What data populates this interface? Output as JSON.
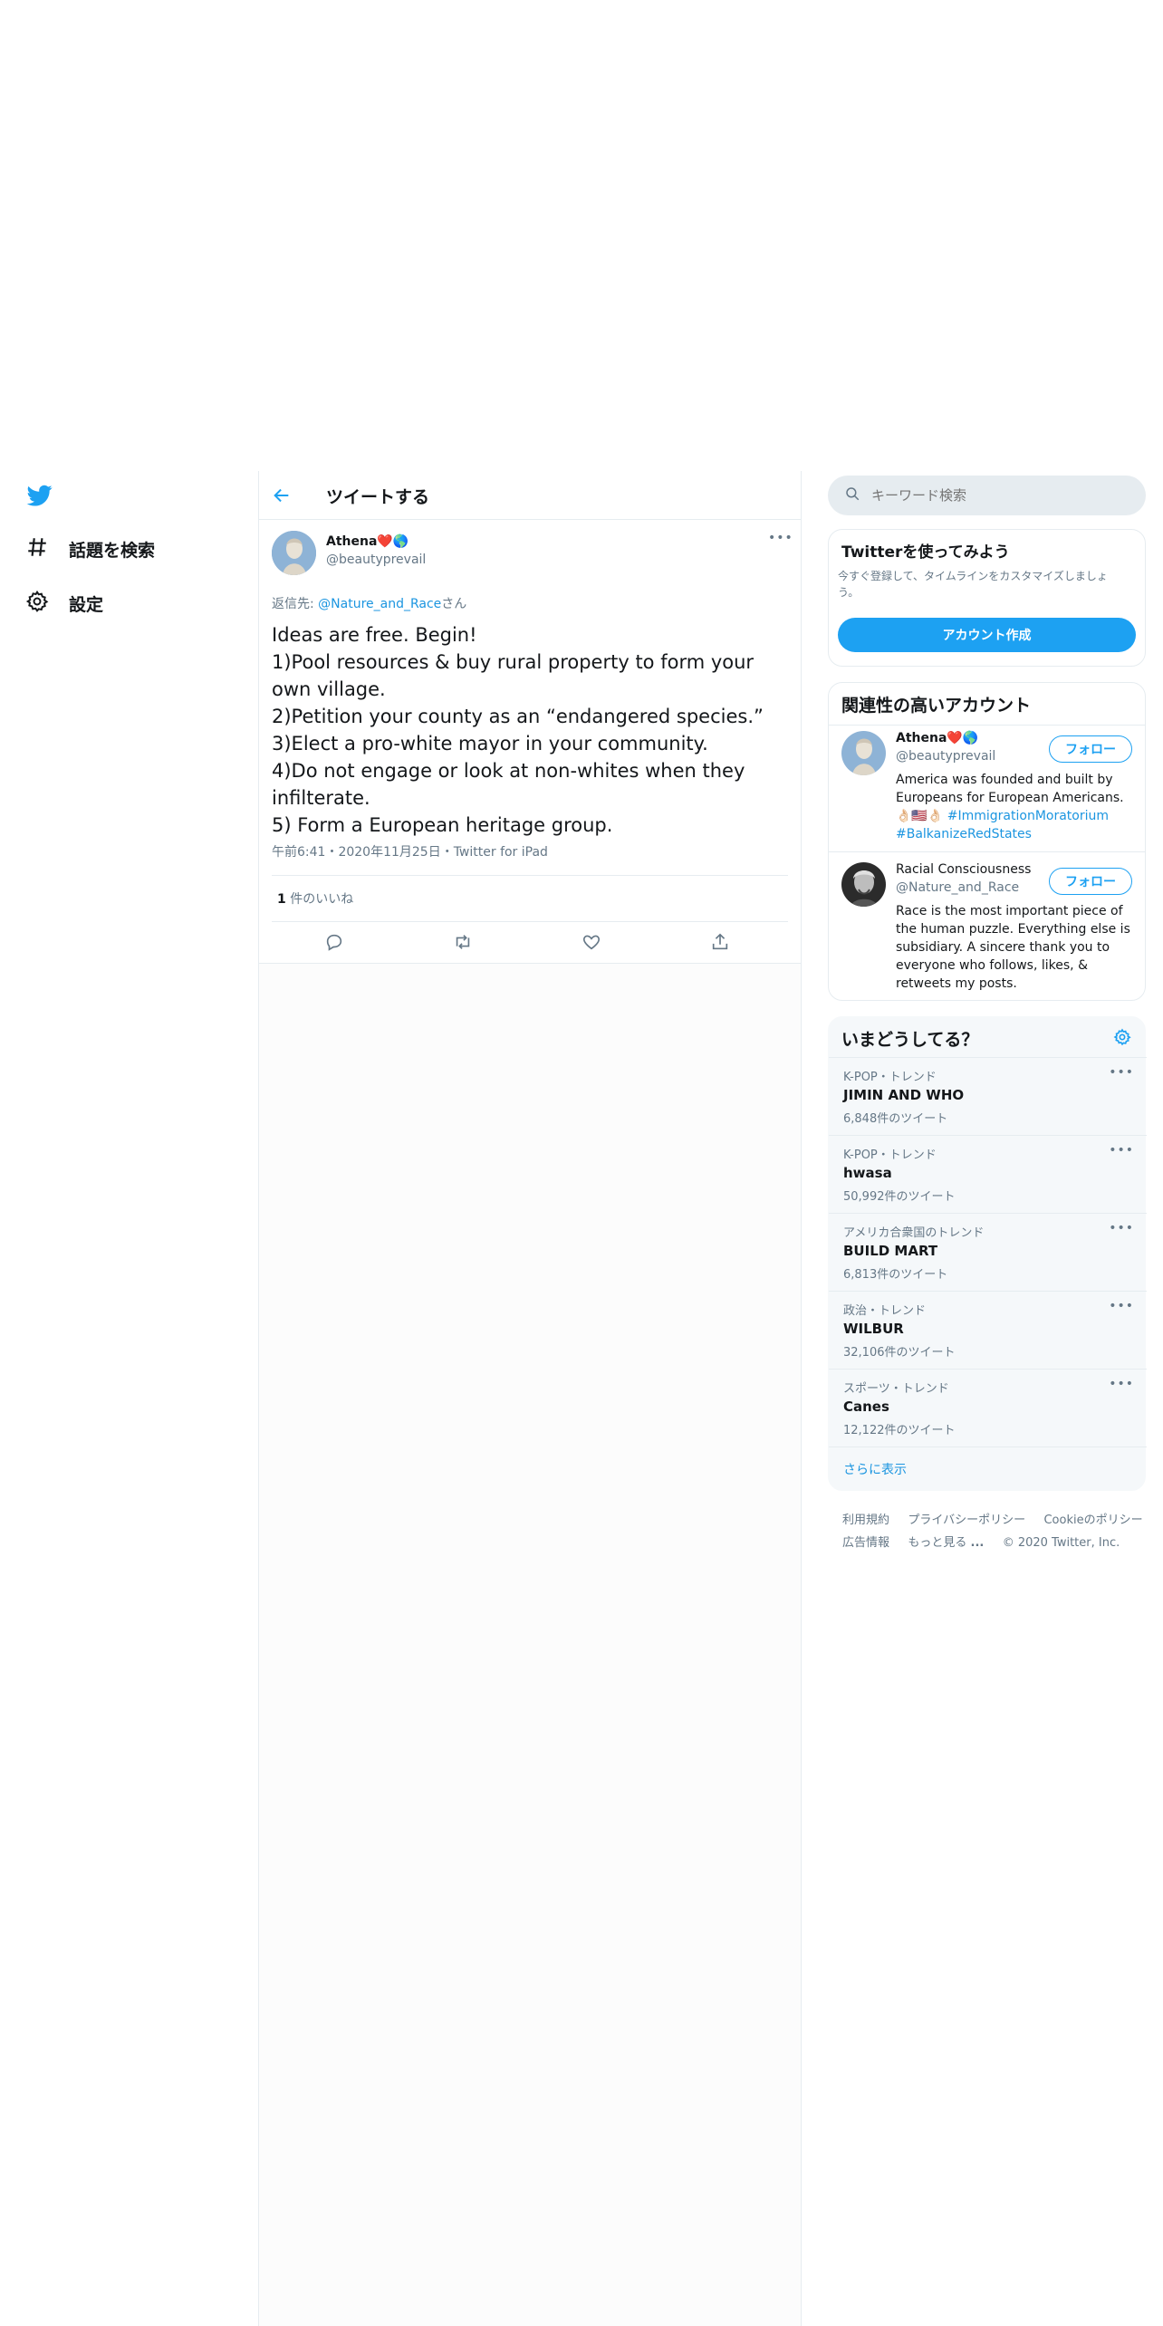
{
  "nav": {
    "items": [
      {
        "icon": "hashtag-icon",
        "label": "話題を検索"
      },
      {
        "icon": "gear-icon",
        "label": "設定"
      }
    ]
  },
  "header": {
    "title": "ツイートする"
  },
  "tweet": {
    "author_name": "Athena❤️🌎",
    "author_handle": "@beautyprevail",
    "reply_prefix": "返信先: ",
    "reply_to": "@Nature_and_Race",
    "reply_suffix": "さん",
    "lines": [
      "Ideas are free. Begin!",
      "1)Pool resources & buy rural property to form your",
      "own village.",
      "2)Petition your county as an “endangered species.”",
      "3)Elect a pro-white mayor in your community.",
      "4)Do not engage or look at non-whites when they",
      "infilterate.",
      "5) Form a European heritage group."
    ],
    "meta": "午前6:41・2020年11月25日・Twitter for iPad",
    "likes_count": "1",
    "likes_label": " 件のいいね"
  },
  "search": {
    "placeholder": "キーワード検索"
  },
  "signup": {
    "title": "Twitterを使ってみよう",
    "desc_line1": "今すぐ登録して、タイムラインをカスタマイズしましょ",
    "desc_line2": "う。",
    "button": "アカウント作成"
  },
  "relevant": {
    "title": "関連性の高いアカウント",
    "follow_label": "フォロー",
    "accounts": [
      {
        "name": "Athena❤️🌎",
        "handle": "@beautyprevail",
        "bio_line1": "America was founded and built by",
        "bio_line2": "Europeans for European Americans.",
        "bio_emoji": "👌🏻🇺🇸👌🏻",
        "bio_tag1": "#ImmigrationMoratorium",
        "bio_tag2": "#BalkanizeRedStates"
      },
      {
        "name": "Racial Consciousness",
        "handle": "@Nature_and_Race",
        "bio_lines": [
          "Race is the most important piece of",
          "the human puzzle. Everything else is",
          "subsidiary. A sincere thank you to",
          "everyone who follows, likes, &",
          "retweets my posts."
        ]
      }
    ]
  },
  "trends": {
    "title": "いまどうしてる？",
    "items": [
      {
        "category": "K-POP・トレンド",
        "name": "JIMIN AND WHO",
        "count": "6,848件のツイート"
      },
      {
        "category": "K-POP・トレンド",
        "name": "hwasa",
        "count": "50,992件のツイート"
      },
      {
        "category": "アメリカ合衆国のトレンド",
        "name": "BUILD MART",
        "count": "6,813件のツイート"
      },
      {
        "category": "政治・トレンド",
        "name": "WILBUR",
        "count": "32,106件のツイート"
      },
      {
        "category": "スポーツ・トレンド",
        "name": "Canes",
        "count": "12,122件のツイート"
      }
    ],
    "more_label": "•••",
    "show_more": "さらに表示"
  },
  "footer": {
    "terms": "利用規約",
    "privacy": "プライバシーポリシー",
    "cookie": "Cookieのポリシー",
    "ads": "広告情報",
    "more": "もっと見る",
    "more_dots": "...",
    "copyright": "© 2020 Twitter, Inc."
  },
  "colors": {
    "accent": "#1da1f2",
    "link": "#1b95e0",
    "muted": "#657786"
  }
}
